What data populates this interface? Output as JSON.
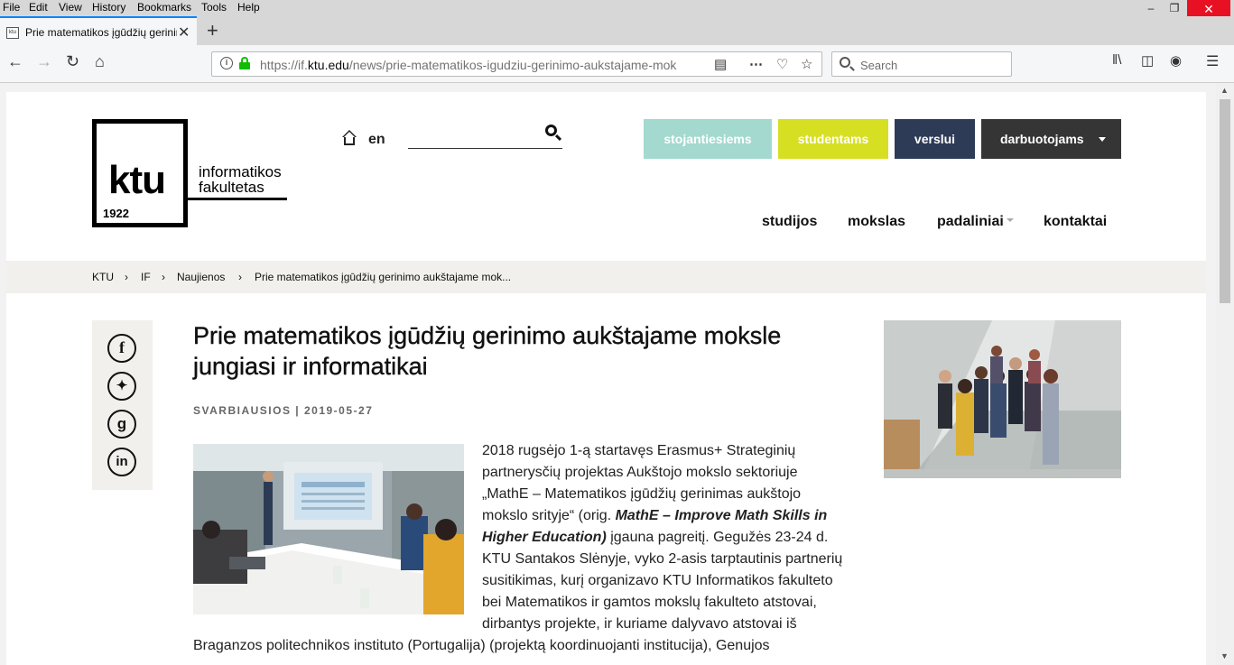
{
  "browser": {
    "menu": [
      "File",
      "Edit",
      "View",
      "History",
      "Bookmarks",
      "Tools",
      "Help"
    ],
    "tab_title": "Prie matematikos įgūdžių gerinimo aukšt...",
    "favicon_text": "ktu",
    "url_prefix": "https://if.",
    "url_domain": "ktu.edu",
    "url_path": "/news/prie-matematikos-igudziu-gerinimo-aukstajame-mok",
    "search_placeholder": "Search"
  },
  "site": {
    "logo_main": "ktu",
    "logo_year": "1922",
    "logo_line1": "informatikos",
    "logo_line2": "fakultetas",
    "lang": "en",
    "audience_buttons": [
      {
        "label": "stojantiesiems",
        "color": "#a3d9cf"
      },
      {
        "label": "studentams",
        "color": "#d7df23"
      },
      {
        "label": "verslui",
        "color": "#2e3b57"
      },
      {
        "label": "darbuotojams",
        "color": "#353535"
      }
    ],
    "nav": [
      "studijos",
      "mokslas",
      "padaliniai",
      "kontaktai"
    ]
  },
  "breadcrumb": [
    "KTU",
    "IF",
    "Naujienos",
    "Prie matematikos įgūdžių gerinimo aukštajame mok..."
  ],
  "article": {
    "title_line1": "Prie matematikos įgūdžių gerinimo aukštajame moksle",
    "title_line2": "jungiasi ir informatikai",
    "meta": "SVARBIAUSIOS | 2019-05-27",
    "lines": [
      "2018 rugsėjo 1-ą startavęs Erasmus+ Strateginių",
      "partnerysčių projektas Aukštojo mokslo sektoriuje",
      "„MathE – Matematikos įgūdžių gerinimas aukštojo",
      "mokslo srityje“ (orig. ",
      "MathE – Improve Math Skills in",
      "Higher Education)",
      " įgauna pagreitį. Gegužės 23-24 d.",
      "KTU Santakos Slėnyje, vyko 2-asis tarptautinis partnerių",
      "susitikimas, kurį organizavo KTU Informatikos fakulteto",
      "bei Matematikos ir gamtos mokslų fakulteto atstovai,",
      "dirbantys projekte, ir kuriame dalyvavo atstovai iš",
      "Braganzos politechnikos instituto (Portugalija) (projektą koordinuojanti institucija), Genujos"
    ]
  },
  "share_icons": [
    "facebook-icon",
    "twitter-icon",
    "google-plus-icon",
    "linkedin-icon"
  ]
}
